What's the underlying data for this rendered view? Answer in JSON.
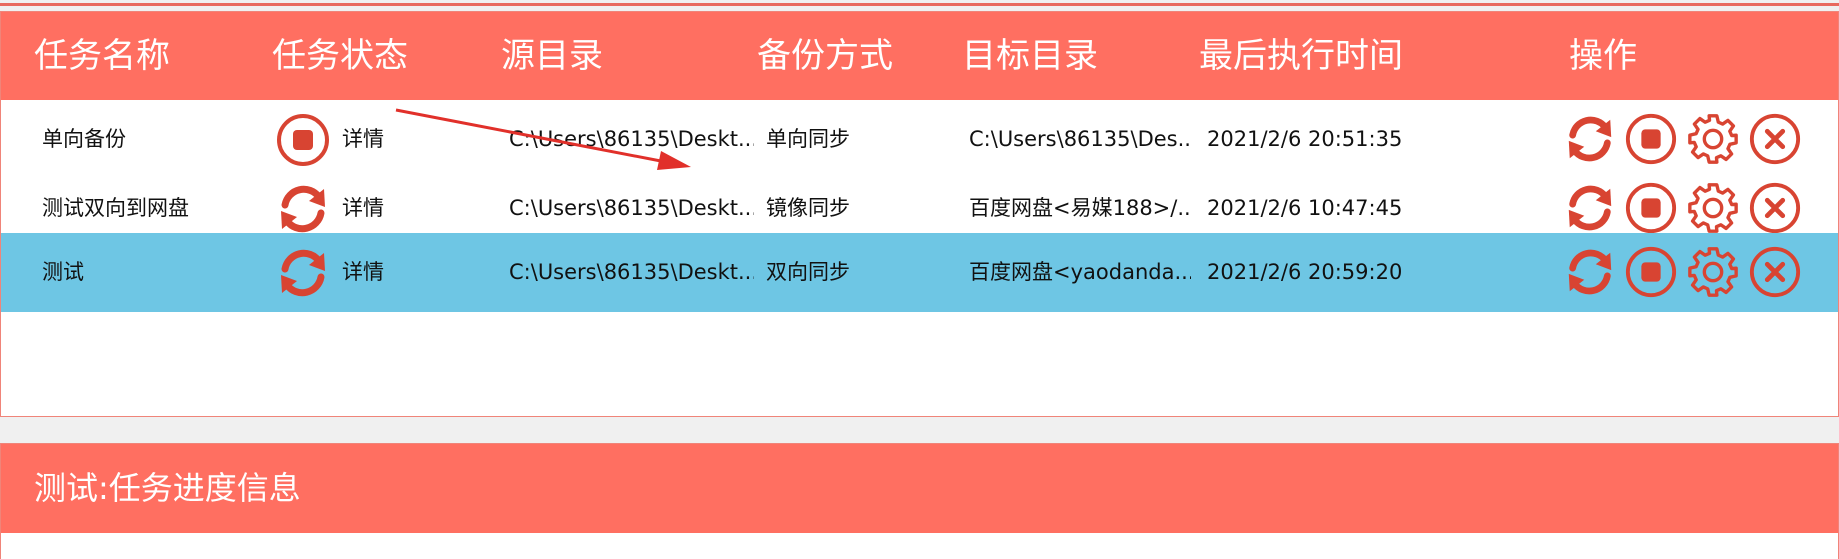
{
  "colors": {
    "accent": "#ff6f61",
    "icon_red": "#d84432",
    "selected_row": "#6ec6e4"
  },
  "columns": [
    "任务名称",
    "任务状态",
    "源目录",
    "备份方式",
    "目标目录",
    "最后执行时间",
    "操作"
  ],
  "tasks": [
    {
      "name": "单向备份",
      "status_icon": "stop-circle-icon",
      "detail": "详情",
      "source": "C:\\Users\\86135\\Deskt...",
      "mode": "单向同步",
      "target": "C:\\Users\\86135\\Des...",
      "last_run": "2021/2/6 20:51:35",
      "selected": false
    },
    {
      "name": "测试双向到网盘",
      "status_icon": "sync-icon",
      "detail": "详情",
      "source": "C:\\Users\\86135\\Deskt...",
      "mode": "镜像同步",
      "target": "百度网盘<易媒188>/...",
      "last_run": "2021/2/6 10:47:45",
      "selected": false
    },
    {
      "name": "测试",
      "status_icon": "sync-icon",
      "detail": "详情",
      "source": "C:\\Users\\86135\\Deskt...",
      "mode": "双向同步",
      "target": "百度网盘<yaodanda...",
      "last_run": "2021/2/6 20:59:20",
      "selected": true
    }
  ],
  "operations": [
    "sync-icon",
    "stop-circle-icon",
    "gear-icon",
    "close-circle-icon"
  ],
  "progress": {
    "title": "测试:任务进度信息"
  }
}
